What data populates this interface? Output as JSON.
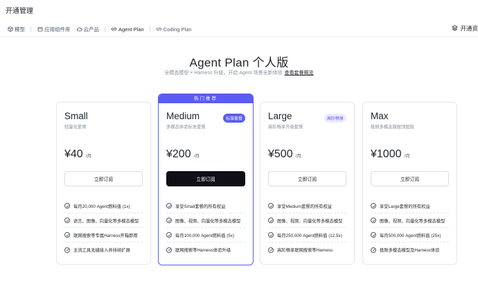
{
  "page": {
    "title": "开通管理"
  },
  "tabs": [
    {
      "label": "模型",
      "icon": "cube-icon"
    },
    {
      "label": "应用组件库",
      "icon": "calendar-icon"
    },
    {
      "label": "云产品",
      "icon": "cloud-icon"
    },
    {
      "label": "Agent Plan",
      "icon": "code-icon",
      "active": true
    },
    {
      "label": "Coding Plan",
      "icon": "code-icon"
    }
  ],
  "top_right": {
    "label": "开通资",
    "icon": "layers-icon"
  },
  "hero": {
    "title": "Agent Plan 个人版",
    "subtitle": "全模态模型 × Harness 升级，开启 Agent 场景全新体验",
    "link": "查看套餐概览"
  },
  "colors": {
    "accent": "#5b5cf0",
    "dark_button": "#0f0f17"
  },
  "plans": [
    {
      "name": "Small",
      "desc": "轻量化使用",
      "price": "¥40",
      "unit": "/月",
      "button": "立即订阅",
      "features": [
        "每月20,000 Agent燃料值 (1x)",
        "语言、图像、向量化等多模态模型",
        "联网搜索等专属Harness开箱即用",
        "主流工具无缝接入并持续扩展"
      ]
    },
    {
      "name": "Medium",
      "desc": "多模态体验标准套餐",
      "badge": "标准套餐",
      "ribbon": "热门推荐",
      "price": "¥200",
      "unit": "/月",
      "button": "立即订阅",
      "features": [
        "享受Small套餐的所有权益",
        "图像、视频、向量化等多模态模型",
        "每月100,000 Agent燃料值 (5x)",
        "联网搜索等Harness体验升级"
      ]
    },
    {
      "name": "Large",
      "desc": "高阶畅享升级套餐",
      "badge": "高阶畅享",
      "price": "¥500",
      "unit": "/月",
      "button": "立即订阅",
      "features": [
        "享受Medium套餐的所有权益",
        "图像、视频、向量化等多模态模型",
        "每月250,000 Agent燃料值 (12.5x)",
        "高阶畅享联网搜索等Harness"
      ]
    },
    {
      "name": "Max",
      "desc": "极致多模态旗舰顶配版",
      "price": "¥1000",
      "unit": "/月",
      "button": "立即订阅",
      "features": [
        "享受Large套餐的所有权益",
        "图像、视频、向量化等多模态模型",
        "每月500,000 Agent燃料值 (25x)",
        "极致多模态模型及Harness体验"
      ]
    }
  ]
}
